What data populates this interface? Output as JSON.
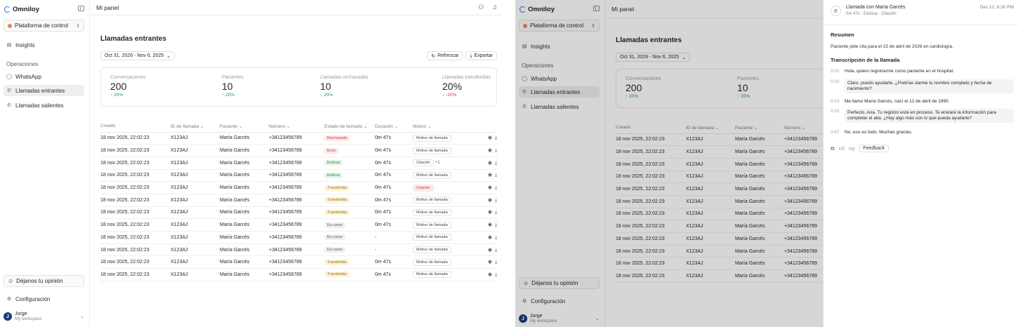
{
  "app": {
    "logo": "Omniloy"
  },
  "sidebar": {
    "org": "Plataforma de control",
    "insights": "Insights",
    "section_ops": "Operaciones",
    "whatsapp": "WhatsApp",
    "incoming": "Llamadas entrantes",
    "outgoing": "Llamadas salientes",
    "feedback": "Déjanos tu opinión",
    "settings": "Configuración",
    "user_name": "Jorge",
    "user_ws": "My workspace",
    "user_initial": "J"
  },
  "topbar": {
    "title": "Mi panel"
  },
  "page": {
    "title": "Llamadas entrantes",
    "daterange": "Oct 31, 2026 - Nov 6, 2025",
    "refresh": "Refrescar",
    "export": "Exportar"
  },
  "stats": [
    {
      "label": "Conversaciones",
      "value": "200",
      "delta": "20%"
    },
    {
      "label": "Pacientes",
      "value": "10",
      "delta": "20%"
    },
    {
      "label": "Llamadas rechazadas",
      "value": "10",
      "delta": "20%"
    },
    {
      "label": "Llamadas transferidas",
      "value": "20%",
      "delta": "-20%"
    }
  ],
  "table": {
    "headers": [
      "Creado",
      "ID de llamada",
      "Paciente",
      "Número",
      "Estado de llamada",
      "Duración",
      "Motivo"
    ],
    "rows": [
      {
        "created": "18 nov 2025, 22:02:23",
        "id": "X123AJ",
        "patient": "María Garcés",
        "number": "+34123456789",
        "status": "Rechazada",
        "duration": "0m 47s",
        "motivo": "Motivo de llamada"
      },
      {
        "created": "18 nov 2025, 22:02:23",
        "id": "X123AJ",
        "patient": "María Garcés",
        "number": "+34123456789",
        "status": "Error",
        "duration": "0m 47s",
        "motivo": "Motivo de llamada"
      },
      {
        "created": "18 nov 2025, 22:02:23",
        "id": "X123AJ",
        "patient": "María Garcés",
        "number": "+34123456789",
        "status": "Exitosa",
        "duration": "0m 47s",
        "motivo": "Citación",
        "extra": "+1"
      },
      {
        "created": "18 nov 2025, 22:02:23",
        "id": "X123AJ",
        "patient": "María Garcés",
        "number": "+34123456789",
        "status": "Exitosa",
        "duration": "0m 47s",
        "motivo": "Motivo de llamada"
      },
      {
        "created": "18 nov 2025, 22:02:23",
        "id": "X123AJ",
        "patient": "María Garcés",
        "number": "+34123456789",
        "status": "Transferida",
        "duration": "0m 47s",
        "motivo": "Urgente"
      },
      {
        "created": "18 nov 2025, 22:02:23",
        "id": "X123AJ",
        "patient": "María Garcés",
        "number": "+34123456789",
        "status": "Transferida",
        "duration": "0m 47s",
        "motivo": "Motivo de llamada"
      },
      {
        "created": "18 nov 2025, 22:02:23",
        "id": "X123AJ",
        "patient": "María Garcés",
        "number": "+34123456789",
        "status": "Transferida",
        "duration": "0m 47s",
        "motivo": "Motivo de llamada"
      },
      {
        "created": "18 nov 2025, 22:02:23",
        "id": "X123AJ",
        "patient": "María Garcés",
        "number": "+34123456789",
        "status": "En curso",
        "duration": "0m 47s",
        "motivo": "Motivo de llamada"
      },
      {
        "created": "18 nov 2025, 22:02:23",
        "id": "X123AJ",
        "patient": "María Garcés",
        "number": "+34123456789",
        "status": "En curso",
        "duration": "-",
        "motivo": "Motivo de llamada"
      },
      {
        "created": "18 nov 2025, 22:02:23",
        "id": "X123AJ",
        "patient": "María Garcés",
        "number": "+34123456789",
        "status": "En curso",
        "duration": "-",
        "motivo": "Motivo de llamada"
      },
      {
        "created": "18 nov 2025, 22:02:23",
        "id": "X123AJ",
        "patient": "María Garcés",
        "number": "+34123456789",
        "status": "Transferida",
        "duration": "0m 47s",
        "motivo": "Motivo de llamada"
      },
      {
        "created": "18 nov 2025, 22:02:23",
        "id": "X123AJ",
        "patient": "María Garcés",
        "number": "+34123456789",
        "status": "Transferida",
        "duration": "0m 47s",
        "motivo": "Motivo de llamada"
      }
    ]
  },
  "panel": {
    "title": "Llamada con María Garcés",
    "duration": "0m 47s",
    "status": "Exitosa",
    "motivo": "Citación",
    "date": "Dec 12, 6:30 PM",
    "summary_title": "Resumen",
    "summary": "Paciente pide cita para el 15 de abril de 2026 en cardiología.",
    "transcript_title": "Transcripción de la llamada",
    "messages": [
      {
        "t": "0:01",
        "text": "Hola, quiero registrarme como paciente en el hospital.",
        "bot": false
      },
      {
        "t": "0:02",
        "text": "Claro, puedo ayudarte. ¿Podrías darme tu nombre completo y fecha de nacimiento?",
        "bot": true
      },
      {
        "t": "0:03",
        "text": "Me llamo María Garcés, nací el 12 de abril de 1990.",
        "bot": false
      },
      {
        "t": "0:15",
        "text": "Perfecto, Ana. Tu registro está en proceso. Te enviaré la información para completar el alta. ¿Hay algo más con lo que pueda ayudarte?",
        "bot": true
      },
      {
        "t": "0:47",
        "text": "No, eso es todo. Muchas gracias.",
        "bot": false
      }
    ],
    "feedback": "Feedback"
  }
}
